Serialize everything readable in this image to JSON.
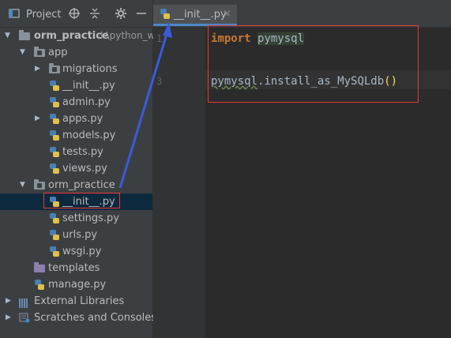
{
  "panel": {
    "title": "Project",
    "toolbar_icons": [
      "project-window-icon",
      "crosshair-icon",
      "collapse-icon",
      "gear-icon",
      "minimize-icon"
    ]
  },
  "tree": {
    "root": {
      "label": "orm_practice",
      "path": "I:\\python_w"
    },
    "app": "app",
    "migrations": "migrations",
    "app_init": "__init__.py",
    "admin": "admin.py",
    "apps": "apps.py",
    "models": "models.py",
    "tests": "tests.py",
    "views": "views.py",
    "orm_practice_pkg": "orm_practice",
    "pkg_init": "__init__.py",
    "settings": "settings.py",
    "urls": "urls.py",
    "wsgi": "wsgi.py",
    "templates": "templates",
    "manage": "manage.py",
    "external_libraries": "External Libraries",
    "scratches": "Scratches and Consoles"
  },
  "editor": {
    "tab_label": "__init__.py",
    "tab_close": "×",
    "line_numbers": [
      "1",
      "3"
    ],
    "code": {
      "line1_keyword": "import",
      "line1_module": "pymysql",
      "line3_module": "pymysql",
      "line3_rest": ".install_as_MySQLdb",
      "line3_parens": "()"
    }
  },
  "colors": {
    "background": "#2b2b2b",
    "panel": "#3c3f41",
    "selection": "#0d293e",
    "highlight_box": "#e8393a",
    "arrow": "#3b5bdb",
    "keyword": "#cc7832"
  }
}
